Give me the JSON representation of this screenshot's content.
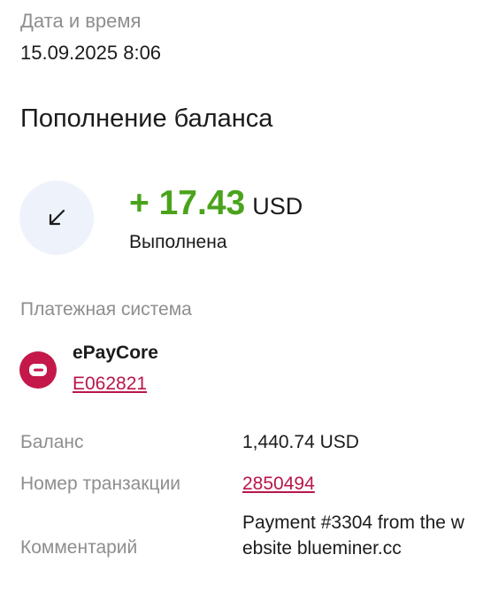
{
  "datetime": {
    "label": "Дата и время",
    "value": "15.09.2025 8:06"
  },
  "title": "Пополнение баланса",
  "transaction": {
    "icon": "arrow-down-left-icon",
    "amount": "+ 17.43",
    "currency": "USD",
    "status": "Выполнена",
    "amount_color": "#4aa31c"
  },
  "payment_system": {
    "label": "Платежная система",
    "logo_icon": "epaycore-logo-icon",
    "logo_color": "#c4184a",
    "name": "ePayCore",
    "account": "E062821"
  },
  "details": {
    "balance_label": "Баланс",
    "balance_value": "1,440.74 USD",
    "tx_number_label": "Номер транзакции",
    "tx_number_value": "2850494",
    "comment_label": "Комментарий",
    "comment_value": "Payment #3304 from the website blueminer.cc"
  },
  "colors": {
    "link": "#b8174a",
    "muted_text": "#8e8e8e",
    "icon_bg": "#eef3fb"
  }
}
